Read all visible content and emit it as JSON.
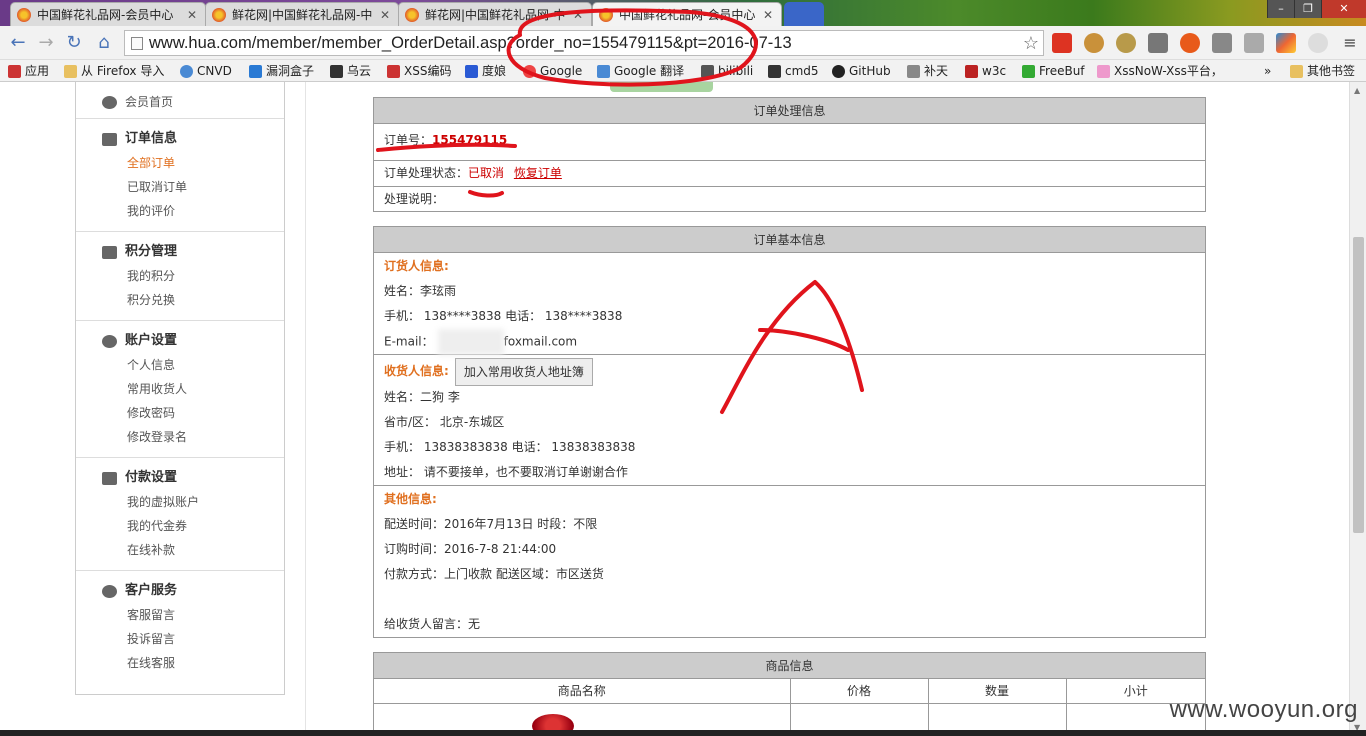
{
  "browser": {
    "tabs": [
      {
        "label": "中国鲜花礼品网-会员中心"
      },
      {
        "label": "鲜花网|中国鲜花礼品网-中"
      },
      {
        "label": "鲜花网|中国鲜花礼品网-中"
      },
      {
        "label": "中国鲜花礼品网-会员中心"
      }
    ],
    "url": "www.hua.com/member/member_OrderDetail.asp?order_no=155479115&pt=2016-07-13",
    "bookmarks": [
      {
        "label": "应用"
      },
      {
        "label": "从 Firefox 导入"
      },
      {
        "label": "CNVD"
      },
      {
        "label": "漏洞盒子"
      },
      {
        "label": "乌云"
      },
      {
        "label": "XSS编码"
      },
      {
        "label": "度娘"
      },
      {
        "label": "Google"
      },
      {
        "label": "Google 翻译"
      },
      {
        "label": "bilibili"
      },
      {
        "label": "cmd5"
      },
      {
        "label": "GitHub"
      },
      {
        "label": "补天"
      },
      {
        "label": "w3c"
      },
      {
        "label": "FreeBuf"
      },
      {
        "label": "XssNoW-Xss平台，"
      },
      {
        "label": "其他书签"
      }
    ],
    "chevron": "»"
  },
  "sidebar": {
    "home": "会员首页",
    "groups": [
      {
        "title": "订单信息",
        "items": [
          "全部订单",
          "已取消订单",
          "我的评价"
        ]
      },
      {
        "title": "积分管理",
        "items": [
          "我的积分",
          "积分兑换"
        ]
      },
      {
        "title": "账户设置",
        "items": [
          "个人信息",
          "常用收货人",
          "修改密码",
          "修改登录名"
        ]
      },
      {
        "title": "付款设置",
        "items": [
          "我的虚拟账户",
          "我的代金券",
          "在线补款"
        ]
      },
      {
        "title": "客户服务",
        "items": [
          "客服留言",
          "投诉留言",
          "在线客服"
        ]
      }
    ]
  },
  "processing": {
    "title": "订单处理信息",
    "order_no_label": "订单号：",
    "order_no": "155479115",
    "status_label": "订单处理状态：",
    "status": "已取消",
    "restore_link": "恢复订单",
    "note_label": "处理说明："
  },
  "basic": {
    "title": "订单基本信息",
    "orderer": {
      "heading": "订货人信息:",
      "name": "姓名：李玹雨",
      "mobile": "手机：  138****3838    电话：  138****3838",
      "email_label": "E-mail：",
      "email_suffix": "foxmail.com"
    },
    "receiver": {
      "heading": "收货人信息:",
      "address_book_button": "加入常用收货人地址簿",
      "name": "姓名：二狗 李",
      "region": "省市/区：  北京-东城区",
      "phones": "手机：  13838383838      电话：  13838383838",
      "address": "地址：  请不要接单，也不要取消订单谢谢合作"
    },
    "other": {
      "heading": "其他信息:",
      "delivery": "配送时间：2016年7月13日    时段：不限",
      "order_time": "订购时间：2016-7-8 21:44:00",
      "payment": "付款方式：上门收款     配送区域：市区送货",
      "message": "给收货人留言：无"
    }
  },
  "goods": {
    "title": "商品信息",
    "columns": [
      "商品名称",
      "价格",
      "数量",
      "小计"
    ]
  },
  "watermark": "www.wooyun.org"
}
